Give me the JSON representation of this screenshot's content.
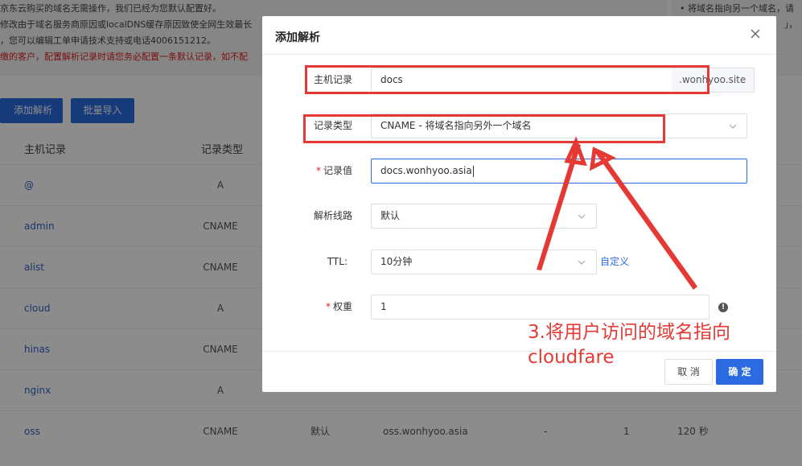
{
  "notice": {
    "lines": [
      "京东云购买的域名无需操作，我们已经为您默认配置好。",
      "修改由于域名服务商原因或localDNS缓存原因致使全网生效最长",
      "，您可以编辑工单申请技术支持或电话4006151212。",
      "缴的客户，配置解析记录时请您务必配置一条默认记录，如不配"
    ],
    "right_lines": [
      "• 将域名指向另一个域名，请",
      "」，"
    ]
  },
  "toolbar": {
    "add_label": "添加解析",
    "import_label": "批量导入"
  },
  "table": {
    "headers": {
      "host": "主机记录",
      "type": "记录类型"
    },
    "rows": [
      {
        "host": "@",
        "type": "A"
      },
      {
        "host": "admin",
        "type": "CNAME"
      },
      {
        "host": "alist",
        "type": "CNAME"
      },
      {
        "host": "cloud",
        "type": "A"
      },
      {
        "host": "hinas",
        "type": "CNAME"
      },
      {
        "host": "nginx",
        "type": "A"
      },
      {
        "host": "oss",
        "type": "CNAME",
        "line": "默认",
        "value": "oss.wonhyoo.asia",
        "mx": "-",
        "weight": "1",
        "ttl": "120 秒"
      }
    ]
  },
  "dialog": {
    "title": "添加解析",
    "host_label": "主机记录",
    "host_value": "docs",
    "host_suffix": ".wonhyoo.site",
    "type_label": "记录类型",
    "type_value": "CNAME - 将域名指向另外一个域名",
    "value_label": "记录值",
    "value_value": "docs.wonhyoo.asia",
    "line_label": "解析线路",
    "line_value": "默认",
    "ttl_label": "TTL:",
    "ttl_value": "10分钟",
    "ttl_custom_link": "自定义",
    "weight_label": "权重",
    "weight_value": "1",
    "required_mark": "*",
    "cancel_label": "取 消",
    "ok_label": "确 定"
  },
  "annotation": {
    "line1": "3.将用户访问的域名指向",
    "line2": "cloudfare",
    "color": "#e53935"
  },
  "colors": {
    "primary": "#2b6ae0",
    "link": "#2f65c5",
    "annotation": "#e53935"
  }
}
